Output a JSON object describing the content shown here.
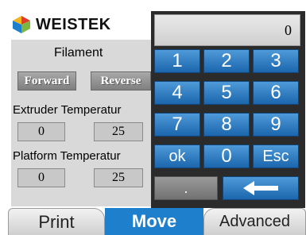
{
  "brand": {
    "name": "WEISTEK",
    "colors": {
      "red": "#e2392b",
      "blue": "#1e7fcd",
      "green": "#7cb83f",
      "yellow": "#f2b31b"
    }
  },
  "left": {
    "filament_title": "Filament",
    "forward_label": "Forward",
    "reverse_label": "Reverse",
    "extruder_title": "Extruder Temperatur",
    "extruder_current": "0",
    "extruder_target": "25",
    "platform_title": "Platform Temperatur",
    "platform_current": "0",
    "platform_target": "25"
  },
  "keypad": {
    "display_value": "0",
    "keys": [
      "1",
      "2",
      "3",
      "4",
      "5",
      "6",
      "7",
      "8",
      "9",
      "ok",
      "0",
      "Esc"
    ],
    "dot": ".",
    "backspace_icon": "left-arrow"
  },
  "tabs": {
    "print": "Print",
    "move": "Move",
    "advanced": "Advanced",
    "active": "Move"
  },
  "colors": {
    "key_blue": "#1b66ad",
    "panel_gray": "#d9d9d9",
    "tab_active": "#1e7fcd"
  }
}
